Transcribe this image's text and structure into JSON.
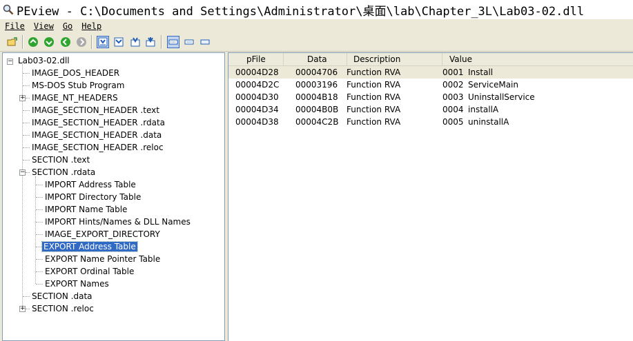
{
  "window": {
    "title": "PEview - C:\\Documents and Settings\\Administrator\\桌面\\lab\\Chapter_3L\\Lab03-02.dll"
  },
  "menu": [
    {
      "label": "File",
      "name": "file"
    },
    {
      "label": "View",
      "name": "view"
    },
    {
      "label": "Go",
      "name": "go"
    },
    {
      "label": "Help",
      "name": "help"
    }
  ],
  "tree": {
    "root": "Lab03-02.dll",
    "items": [
      {
        "label": "IMAGE_DOS_HEADER"
      },
      {
        "label": "MS-DOS Stub Program"
      },
      {
        "label": "IMAGE_NT_HEADERS"
      },
      {
        "label": "IMAGE_SECTION_HEADER .text"
      },
      {
        "label": "IMAGE_SECTION_HEADER .rdata"
      },
      {
        "label": "IMAGE_SECTION_HEADER .data"
      },
      {
        "label": "IMAGE_SECTION_HEADER .reloc"
      },
      {
        "label": "SECTION .text"
      },
      {
        "label": "SECTION .rdata"
      },
      {
        "label": "IMPORT Address Table"
      },
      {
        "label": "IMPORT Directory Table"
      },
      {
        "label": "IMPORT Name Table"
      },
      {
        "label": "IMPORT Hints/Names & DLL Names"
      },
      {
        "label": "IMAGE_EXPORT_DIRECTORY"
      },
      {
        "label": "EXPORT Address Table"
      },
      {
        "label": "EXPORT Name Pointer Table"
      },
      {
        "label": "EXPORT Ordinal Table"
      },
      {
        "label": "EXPORT Names"
      },
      {
        "label": "SECTION .data"
      },
      {
        "label": "SECTION .reloc"
      }
    ]
  },
  "table": {
    "columns": [
      "pFile",
      "Data",
      "Description",
      "Value"
    ],
    "rows": [
      {
        "pfile": "00004D28",
        "data": "00004706",
        "description": "Function RVA",
        "ordinal": "0001",
        "name": "Install"
      },
      {
        "pfile": "00004D2C",
        "data": "00003196",
        "description": "Function RVA",
        "ordinal": "0002",
        "name": "ServiceMain"
      },
      {
        "pfile": "00004D30",
        "data": "00004B18",
        "description": "Function RVA",
        "ordinal": "0003",
        "name": "UninstallService"
      },
      {
        "pfile": "00004D34",
        "data": "00004B0B",
        "description": "Function RVA",
        "ordinal": "0004",
        "name": "installA"
      },
      {
        "pfile": "00004D38",
        "data": "00004C2B",
        "description": "Function RVA",
        "ordinal": "0005",
        "name": "uninstallA"
      }
    ]
  },
  "colors": {
    "selection": "#316ac5",
    "pane_border": "#7f9db9",
    "face": "#ece9d8"
  },
  "icons": [
    "magnifier-icon",
    "open-folder-icon",
    "up-icon",
    "down-icon",
    "back-icon",
    "forward-icon",
    "view-byte-icon",
    "view-word-icon",
    "view-dword-icon",
    "view-qword-icon",
    "view-list-icon",
    "view-hex-icon",
    "view-text-icon"
  ]
}
